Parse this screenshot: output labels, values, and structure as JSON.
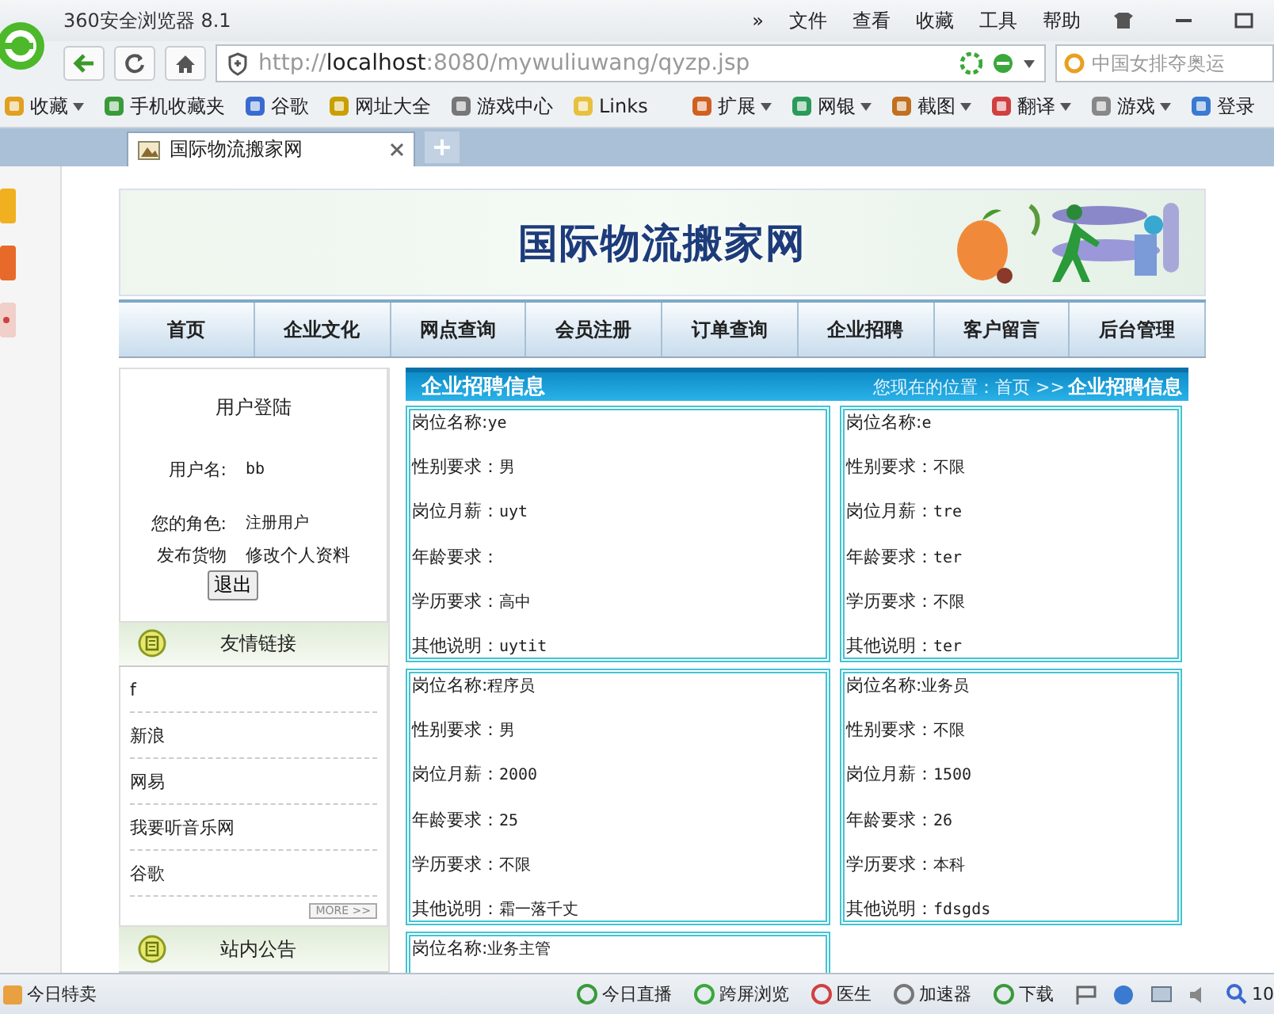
{
  "browser": {
    "title": "360安全浏览器 8.1",
    "menu": [
      "»",
      "文件",
      "查看",
      "收藏",
      "工具",
      "帮助"
    ],
    "url": "http://**localhost**:8080/mywuliuwang/qyzp.jsp",
    "search": "中国女排夺奥运",
    "bookmarks": [
      {
        "label": "收藏",
        "dropdown": true
      },
      {
        "label": "手机收藏夹",
        "dropdown": false
      },
      {
        "label": "谷歌",
        "dropdown": false
      },
      {
        "label": "网址大全",
        "dropdown": false
      },
      {
        "label": "游戏中心",
        "dropdown": false
      },
      {
        "label": "Links",
        "dropdown": false
      }
    ],
    "tools": [
      {
        "label": "扩展",
        "dropdown": true
      },
      {
        "label": "网银",
        "dropdown": true
      },
      {
        "label": "截图",
        "dropdown": true
      },
      {
        "label": "翻译",
        "dropdown": true
      },
      {
        "label": "游戏",
        "dropdown": true
      },
      {
        "label": "登录",
        "dropdown": false
      }
    ],
    "tabs": [
      {
        "label": "国际物流搬家网",
        "selected": true
      }
    ]
  },
  "site": {
    "title": "国际物流搬家网",
    "nav": [
      "首页",
      "企业文化",
      "网点查询",
      "会员注册",
      "订单查询",
      "企业招聘",
      "客户留言",
      "后台管理"
    ],
    "login": {
      "title": "用户登陆",
      "rows": [
        {
          "label": "用户名:",
          "value": "bb"
        },
        {
          "label": "您的角色:",
          "value": "注册用户"
        }
      ],
      "links": [
        "发布货物",
        "修改个人资料"
      ],
      "logout": "退出"
    },
    "friend_links": {
      "title": "友情链接",
      "items": [
        "f",
        "新浪",
        "网易",
        "我要听音乐网",
        "谷歌"
      ],
      "more": "MORE >>"
    },
    "notice": {
      "title": "站内公告"
    },
    "section": {
      "title": "企业招聘信息",
      "location": "您现在的位置：首页 >>",
      "current": "企业招聘信息"
    },
    "jobs": [
      {
        "fields": [
          {
            "label": "岗位名称:",
            "value": "ye"
          },
          {
            "label": "性别要求：",
            "value": "男"
          },
          {
            "label": "岗位月薪：",
            "value": "uyt"
          },
          {
            "label": "年龄要求："
          },
          {
            "label": "学历要求：",
            "value": "高中"
          },
          {
            "label": "其他说明：",
            "value": "uytit"
          }
        ]
      },
      {
        "fields": [
          {
            "label": "岗位名称:",
            "value": "e"
          },
          {
            "label": "性别要求：",
            "value": "不限"
          },
          {
            "label": "岗位月薪：",
            "value": "tre"
          },
          {
            "label": "年龄要求：",
            "value": "ter"
          },
          {
            "label": "学历要求：",
            "value": "不限"
          },
          {
            "label": "其他说明：",
            "value": "ter"
          }
        ]
      },
      {
        "fields": [
          {
            "label": "岗位名称:",
            "value": "程序员"
          },
          {
            "label": "性别要求：",
            "value": "男"
          },
          {
            "label": "岗位月薪：",
            "value": "2000"
          },
          {
            "label": "年龄要求：",
            "value": "25"
          },
          {
            "label": "学历要求：",
            "value": "不限"
          },
          {
            "label": "其他说明：",
            "value": "霜一落千丈"
          }
        ]
      },
      {
        "fields": [
          {
            "label": "岗位名称:",
            "value": "业务员"
          },
          {
            "label": "性别要求：",
            "value": "不限"
          },
          {
            "label": "岗位月薪：",
            "value": "1500"
          },
          {
            "label": "年龄要求：",
            "value": "26"
          },
          {
            "label": "学历要求：",
            "value": "本科"
          },
          {
            "label": "其他说明：",
            "value": "fdsgds"
          }
        ]
      },
      {
        "fields": [
          {
            "label": "岗位名称:",
            "value": "业务主管"
          }
        ]
      }
    ]
  },
  "status_bar": {
    "left": "今日特卖",
    "items": [
      "今日直播",
      "跨屏浏览",
      "医生",
      "加速器",
      "下载"
    ],
    "zoom": "10"
  }
}
